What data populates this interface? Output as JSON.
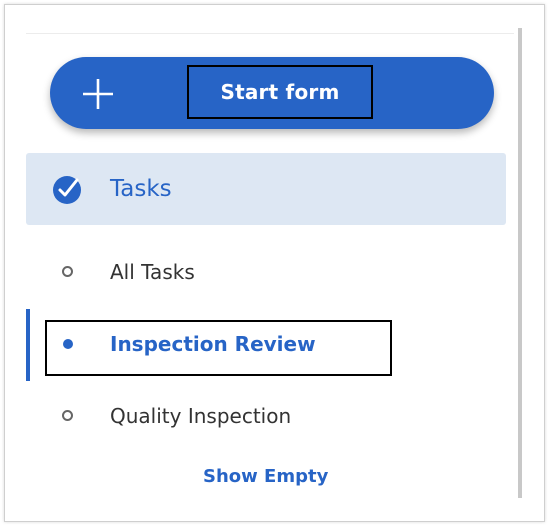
{
  "start_button": {
    "label": "Start form",
    "icon": "plus-icon"
  },
  "tasks": {
    "label": "Tasks",
    "icon": "check-circle-icon"
  },
  "nav_items": [
    {
      "label": "All Tasks",
      "active": false
    },
    {
      "label": "Inspection Review",
      "active": true
    },
    {
      "label": "Quality Inspection",
      "active": false
    }
  ],
  "show_empty": {
    "label": "Show Empty"
  },
  "colors": {
    "accent": "#2764c6",
    "tasks_bg": "#dde7f3",
    "text": "#333333"
  }
}
